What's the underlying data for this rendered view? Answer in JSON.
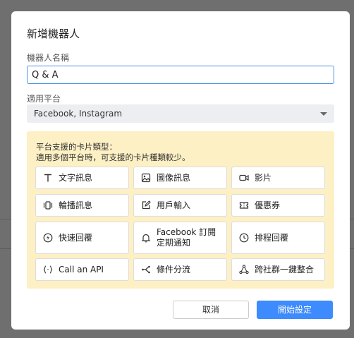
{
  "dialog": {
    "title": "新增機器人",
    "name_label": "機器人名稱",
    "name_value": "Q & A",
    "platform_label": "適用平台",
    "platform_value": "Facebook, Instagram",
    "info": {
      "line1": "平台支援的卡片類型：",
      "line2": "適用多個平台時，可支援的卡片種類較少。"
    },
    "cards": [
      {
        "label": "文字訊息",
        "icon": "text-icon"
      },
      {
        "label": "圖像訊息",
        "icon": "image-icon"
      },
      {
        "label": "影片",
        "icon": "video-icon"
      },
      {
        "label": "輪播訊息",
        "icon": "carousel-icon"
      },
      {
        "label": "用戶輸入",
        "icon": "edit-icon"
      },
      {
        "label": "優惠券",
        "icon": "coupon-icon"
      },
      {
        "label": "快速回覆",
        "icon": "lightning-icon"
      },
      {
        "label": "Facebook 訂閱\n定期通知",
        "icon": "bell-icon"
      },
      {
        "label": "排程回覆",
        "icon": "clock-icon"
      },
      {
        "label": "Call an API",
        "icon": "code-braces-icon"
      },
      {
        "label": "條件分流",
        "icon": "branch-icon"
      },
      {
        "label": "跨社群一鍵整合",
        "icon": "network-icon"
      }
    ],
    "cancel_label": "取消",
    "start_label": "開始設定"
  },
  "colors": {
    "accent": "#3d8bfd",
    "info_bg": "#fdf0c4",
    "backdrop": "#6f6f6f"
  }
}
